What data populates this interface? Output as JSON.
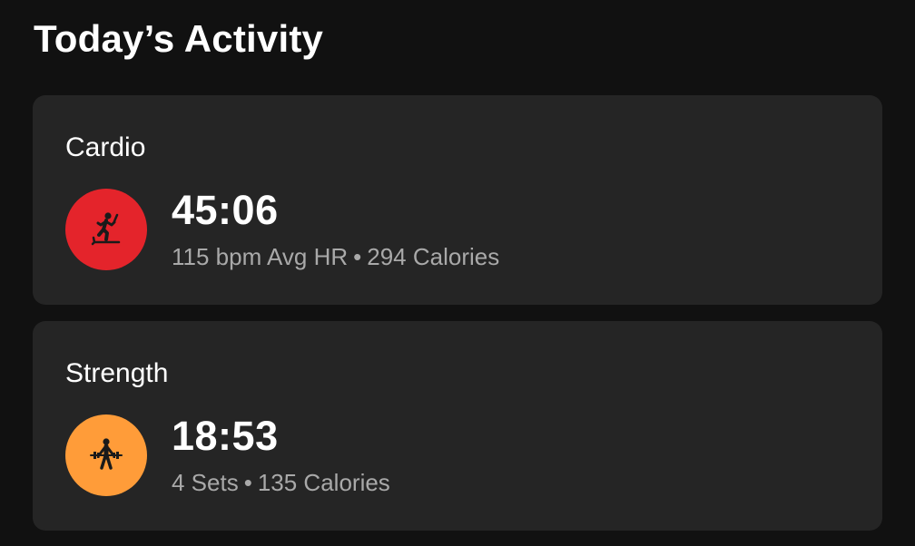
{
  "page": {
    "title": "Today’s Activity"
  },
  "activities": [
    {
      "name": "Cardio",
      "icon": "treadmill-runner-icon",
      "icon_color": "#E4242B",
      "duration": "45:06",
      "stat_1": "115 bpm Avg HR",
      "separator": "•",
      "stat_2": "294 Calories"
    },
    {
      "name": "Strength",
      "icon": "weightlifter-icon",
      "icon_color": "#FF9C39",
      "duration": "18:53",
      "stat_1": "4 Sets",
      "separator": "•",
      "stat_2": "135 Calories"
    }
  ]
}
